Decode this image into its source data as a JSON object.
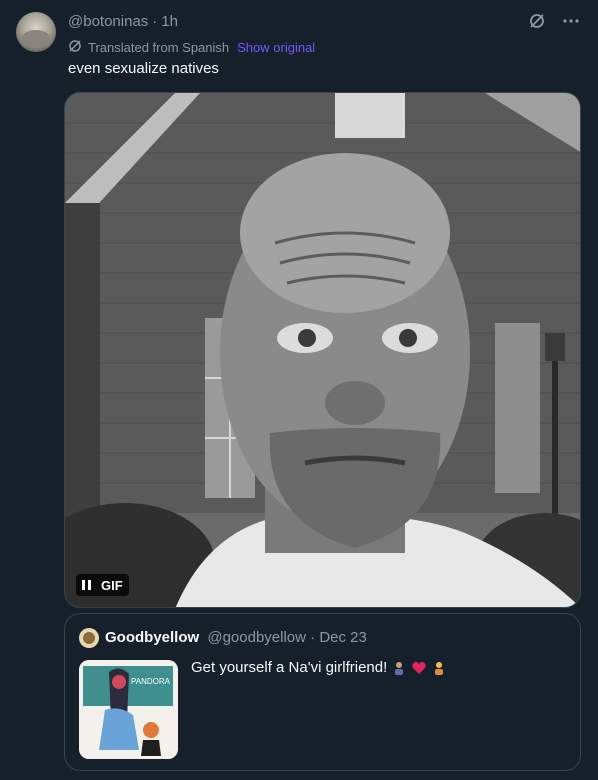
{
  "tweet": {
    "handle": "@botoninas",
    "time": "1h",
    "translated_label": "Translated from Spanish",
    "show_original": "Show original",
    "text": "even sexualize natives",
    "media_badge": "GIF"
  },
  "quote": {
    "name": "Goodbyellow",
    "handle": "@goodbyellow",
    "date": "Dec 23",
    "text": "Get yourself a Na'vi girlfriend!",
    "thumb_text": "PANDORA",
    "emojis": [
      "person-emoji",
      "red-heart-emoji",
      "person-emoji"
    ]
  },
  "colors": {
    "background": "#15202b",
    "accent": "#7856ff",
    "muted": "#8b98a5",
    "border": "#38444d"
  }
}
